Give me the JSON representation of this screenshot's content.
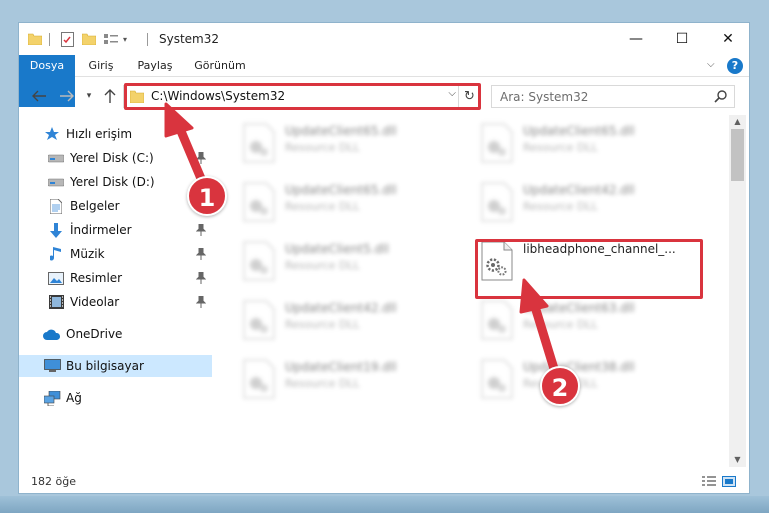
{
  "window": {
    "title": "System32",
    "controls": {
      "minimize": "—",
      "maximize": "☐",
      "close": "✕"
    }
  },
  "ribbon": {
    "tabs": [
      {
        "label": "Dosya"
      },
      {
        "label": "Giriş"
      },
      {
        "label": "Paylaş"
      },
      {
        "label": "Görünüm"
      }
    ],
    "help_label": "?"
  },
  "navigation": {
    "address": "C:\\Windows\\System32",
    "search_placeholder": "Ara: System32"
  },
  "sidebar": {
    "items": [
      {
        "label": "Hızlı erişim",
        "icon": "star-icon"
      },
      {
        "label": "Yerel Disk (C:)",
        "icon": "drive-icon",
        "pinned": true
      },
      {
        "label": "Yerel Disk (D:)",
        "icon": "drive-icon",
        "pinned": false
      },
      {
        "label": "Belgeler",
        "icon": "document-icon",
        "pinned": true
      },
      {
        "label": "İndirmeler",
        "icon": "download-icon",
        "pinned": true
      },
      {
        "label": "Müzik",
        "icon": "music-icon",
        "pinned": true
      },
      {
        "label": "Resimler",
        "icon": "pictures-icon",
        "pinned": true
      },
      {
        "label": "Videolar",
        "icon": "video-icon",
        "pinned": true
      },
      {
        "label": "OneDrive",
        "icon": "cloud-icon"
      },
      {
        "label": "Bu bilgisayar",
        "icon": "computer-icon",
        "selected": true
      },
      {
        "label": "Ağ",
        "icon": "network-icon"
      }
    ]
  },
  "files": [
    {
      "name": "UpdateClient65.dll",
      "type": "Resource DLL"
    },
    {
      "name": "UpdateClient65.dll",
      "type": "Resource DLL"
    },
    {
      "name": "UpdateClient65.dll",
      "type": "Resource DLL"
    },
    {
      "name": "UpdateClient42.dll",
      "type": "Resource DLL"
    },
    {
      "name": "UpdateClient5.dll",
      "type": "Resource DLL"
    },
    {
      "name": "libheadphone_channel_...",
      "type": ""
    },
    {
      "name": "UpdateClient42.dll",
      "type": "Resource DLL"
    },
    {
      "name": "UpdateClient63.dll",
      "type": "Resource DLL"
    },
    {
      "name": "UpdateClient19.dll",
      "type": "Resource DLL"
    },
    {
      "name": "UpdateClient38.dll",
      "type": "Resource DLL"
    }
  ],
  "status": {
    "item_count": "182 öğe"
  },
  "annotations": {
    "step1": "1",
    "step2": "2"
  },
  "colors": {
    "accent": "#1979ca",
    "highlight": "#d9343e",
    "selection": "#cce8ff"
  }
}
